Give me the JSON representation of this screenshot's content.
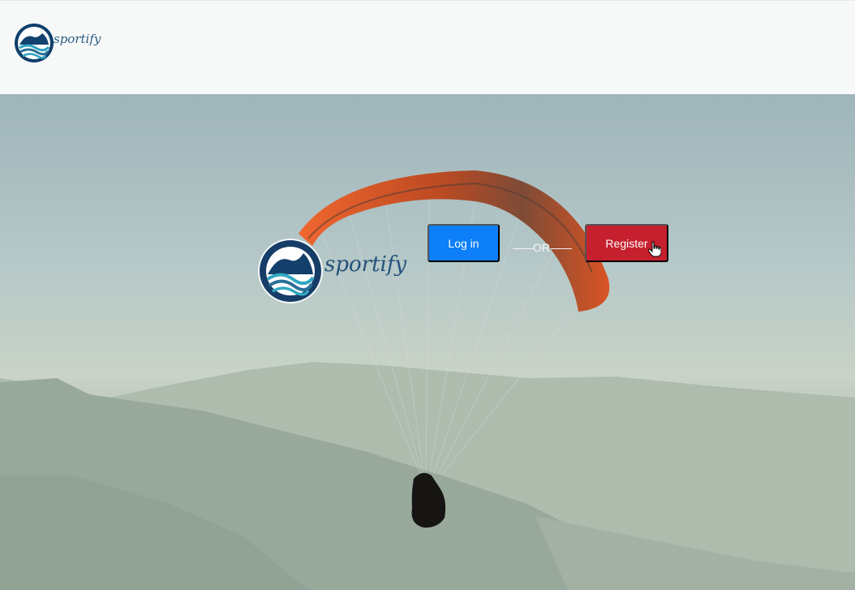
{
  "header": {
    "brand": "sportify"
  },
  "hero": {
    "brand": "sportify",
    "login_label": "Log in",
    "or_label": "OR",
    "register_label": "Register"
  },
  "colors": {
    "login": "#0d7ff8",
    "register": "#c6202e",
    "brand": "#24527a"
  },
  "icons": {
    "logo": "sportify-wave-logo-icon",
    "cursor": "hand-pointer-icon"
  }
}
